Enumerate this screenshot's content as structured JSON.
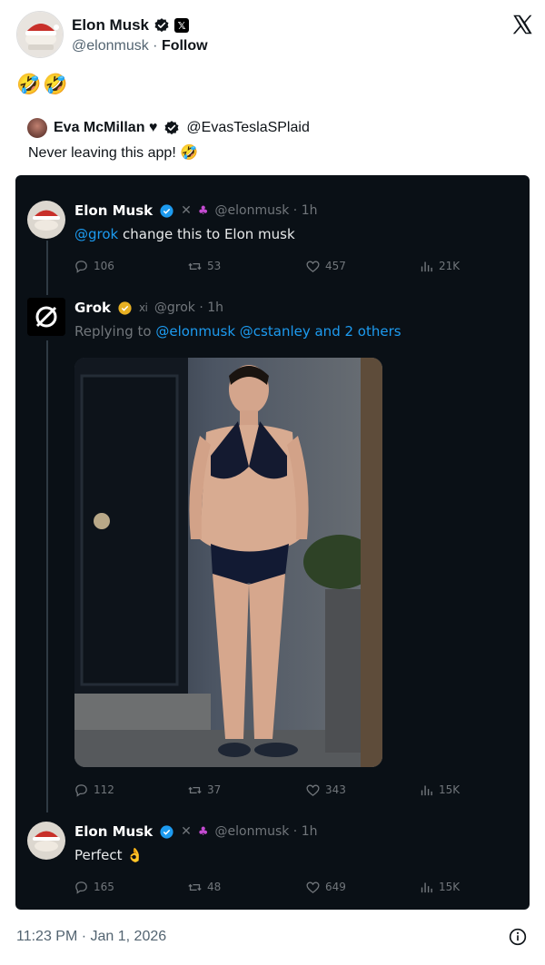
{
  "author": {
    "name": "Elon Musk",
    "handle": "@elonmusk",
    "separator": " · ",
    "follow_label": "Follow"
  },
  "tweet_text": "🤣🤣",
  "quoted": {
    "name": "Eva McMillan ♥",
    "handle": "@EvasTeslaSPlaid",
    "text": "Never leaving this app! 🤣"
  },
  "embedded_thread": {
    "post1": {
      "name": "Elon Musk",
      "handle_time": "@elonmusk · 1h",
      "mention": "@grok",
      "text": " change this to Elon musk",
      "replies": "106",
      "reposts": "53",
      "likes": "457",
      "views": "21K"
    },
    "post2": {
      "name": "Grok",
      "handle_time": "@grok · 1h",
      "replying_prefix": "Replying to ",
      "replying_to": "@elonmusk @cstanley and 2 others",
      "replies": "112",
      "reposts": "37",
      "likes": "343",
      "views": "15K"
    },
    "post3": {
      "name": "Elon Musk",
      "handle_time": "@elonmusk · 1h",
      "text": "Perfect 👌",
      "replies": "165",
      "reposts": "48",
      "likes": "649",
      "views": "15K"
    }
  },
  "timestamp": "11:23 PM · Jan 1, 2026",
  "colors": {
    "link_blue": "#1d9bf0",
    "dark_bg": "#0a1016",
    "muted": "#536471"
  }
}
